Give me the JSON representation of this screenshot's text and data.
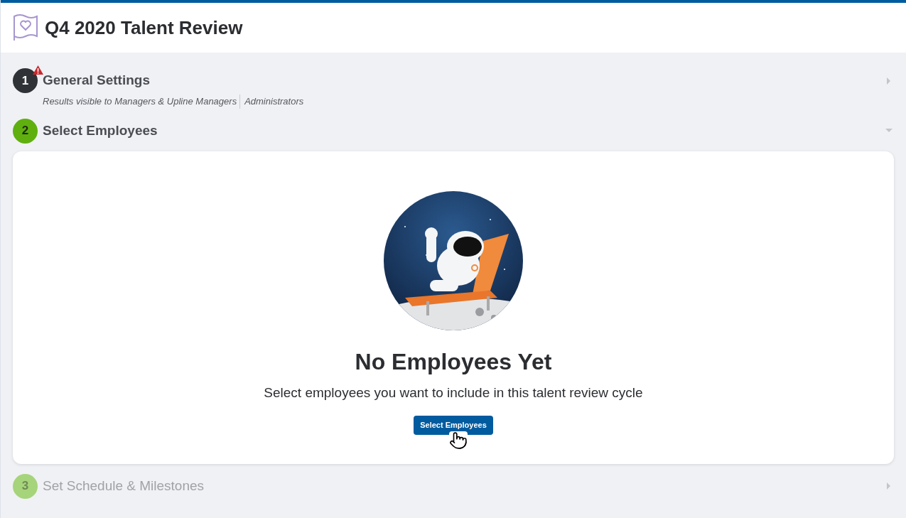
{
  "page": {
    "title": "Q4 2020 Talent Review"
  },
  "steps": [
    {
      "number": "1",
      "title": "General Settings",
      "kind": "complete",
      "warning": true,
      "expanded": false,
      "details": [
        "Results visible to Managers & Upline Managers",
        "Administrators"
      ]
    },
    {
      "number": "2",
      "title": "Select Employees",
      "kind": "active",
      "warning": false,
      "expanded": true,
      "empty_state": {
        "heading": "No Employees Yet",
        "message": "Select employees you want to include in this talent review cycle",
        "button": "Select Employees"
      }
    },
    {
      "number": "3",
      "title": "Set Schedule & Milestones",
      "kind": "upcoming",
      "warning": false,
      "expanded": false
    }
  ]
}
